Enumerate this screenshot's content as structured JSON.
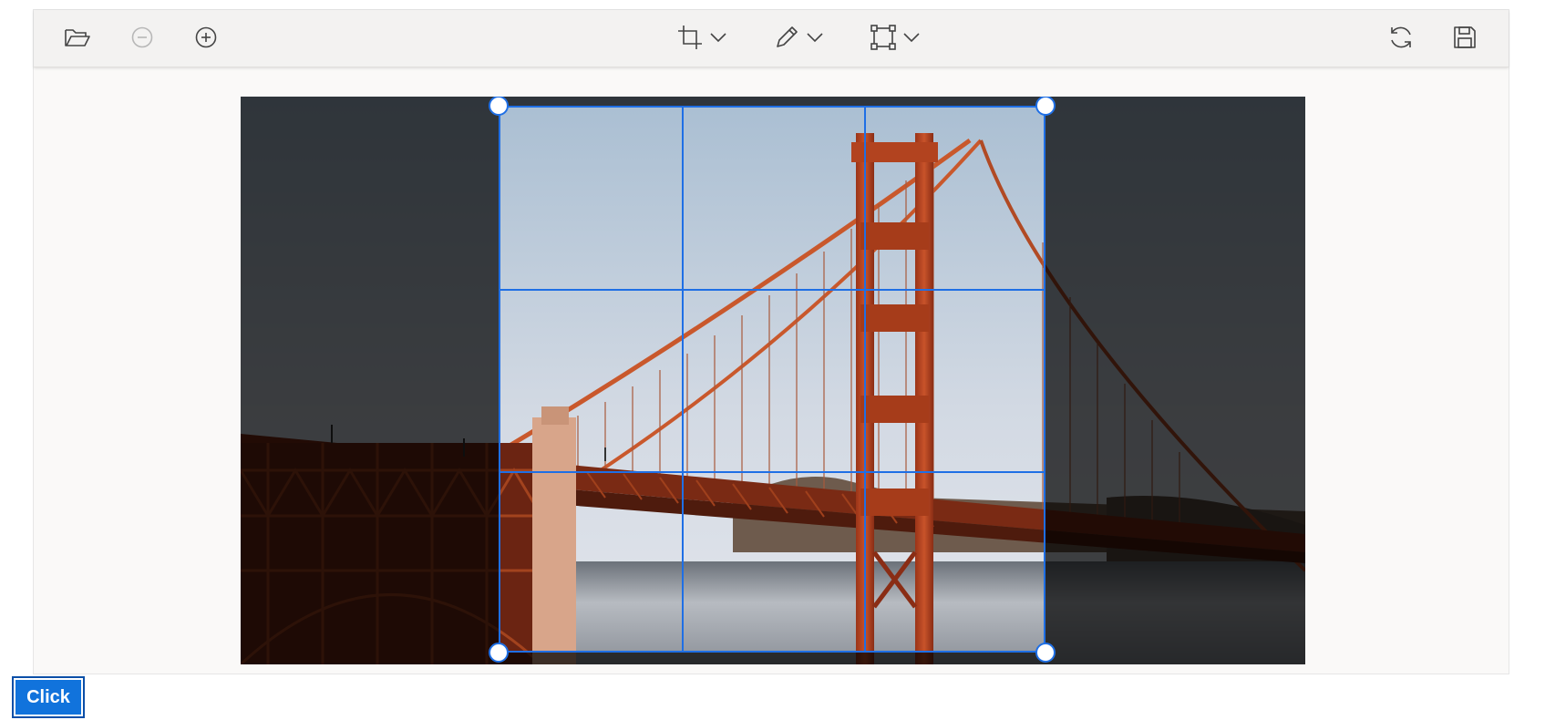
{
  "toolbar": {
    "left_icons": [
      "folder-open-icon",
      "zoom-out-icon",
      "zoom-in-icon"
    ],
    "center_dropdowns": [
      "crop-icon",
      "pen-icon",
      "transform-icon"
    ],
    "right_icons": [
      "reset-icon",
      "save-icon"
    ]
  },
  "image": {
    "subject": "golden-gate-bridge-photo"
  },
  "crop": {
    "grid": "3x3",
    "accent": "#1f6fe5"
  },
  "button": {
    "label": "Click",
    "color": "#1173dc"
  }
}
